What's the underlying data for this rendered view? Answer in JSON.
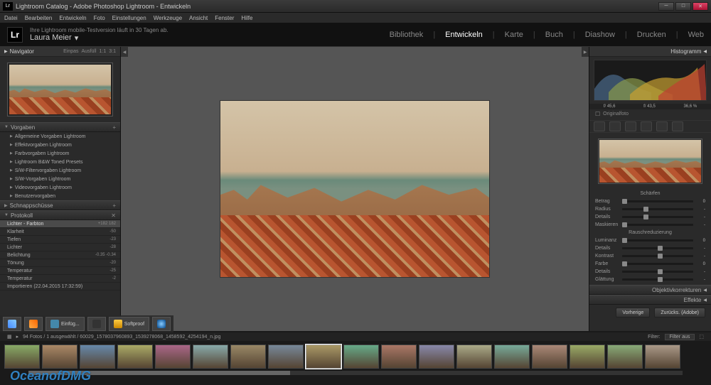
{
  "window": {
    "title": "Lightroom Catalog - Adobe Photoshop Lightroom - Entwickeln"
  },
  "menu": [
    "Datei",
    "Bearbeiten",
    "Entwickeln",
    "Foto",
    "Einstellungen",
    "Werkzeuge",
    "Ansicht",
    "Fenster",
    "Hilfe"
  ],
  "identity": {
    "trial": "Ihre Lightroom mobile-Testversion läuft in 30 Tagen ab.",
    "user": "Laura Meier"
  },
  "modules": [
    "Bibliothek",
    "Entwickeln",
    "Karte",
    "Buch",
    "Diashow",
    "Drucken",
    "Web"
  ],
  "active_module": "Entwickeln",
  "left": {
    "navigator": {
      "title": "Navigator",
      "zoom_labels": [
        "Einpas",
        "Ausfüll",
        "1:1",
        "3:1"
      ]
    },
    "presets": {
      "title": "Vorgaben",
      "items": [
        "Allgemeine Vorgaben Lightroom",
        "Effektvorgaben Lightroom",
        "Farbvorgaben Lightroom",
        "Lightroom B&W Toned Presets",
        "S/W-Filtervorgaben Lightroom",
        "S/W-Vorgaben Lightroom",
        "Videovorgaben Lightroom",
        "Benutzervorgaben"
      ]
    },
    "snapshots": {
      "title": "Schnappschüsse"
    },
    "history": {
      "title": "Protokoll",
      "items": [
        {
          "label": "Lichter - Farbton",
          "val": "+182   182"
        },
        {
          "label": "Klarheit",
          "val": "-50"
        },
        {
          "label": "Tiefen",
          "val": "-23"
        },
        {
          "label": "Lichter",
          "val": "-28"
        },
        {
          "label": "Belichtung",
          "val": "-0.35     -0.34"
        },
        {
          "label": "Tönung",
          "val": "-20"
        },
        {
          "label": "Temperatur",
          "val": "-25"
        },
        {
          "label": "Temperatur",
          "val": "-2"
        },
        {
          "label": "Importieren (22.04.2015 17:32:59)",
          "val": ""
        }
      ]
    }
  },
  "right": {
    "histogram": {
      "title": "Histogramm",
      "stats": [
        "f/ 45,6",
        "f/ 43,5",
        "36,6 %"
      ],
      "original": "Originalfoto"
    },
    "detail": {
      "sharpen": {
        "title": "Schärfen",
        "sliders": [
          {
            "lbl": "Betrag",
            "val": "0",
            "pos": 0
          },
          {
            "lbl": "Radius",
            "val": "-",
            "pos": 30
          },
          {
            "lbl": "Details",
            "val": "-",
            "pos": 30
          },
          {
            "lbl": "Maskieren",
            "val": "-",
            "pos": 0
          }
        ]
      },
      "noise": {
        "title": "Rauschreduzierung",
        "sliders": [
          {
            "lbl": "Luminanz",
            "val": "0",
            "pos": 0
          },
          {
            "lbl": "Details",
            "val": "-",
            "pos": 50
          },
          {
            "lbl": "Kontrast",
            "val": "-",
            "pos": 50
          },
          {
            "lbl": "Farbe",
            "val": "0",
            "pos": 0
          },
          {
            "lbl": "Details",
            "val": "-",
            "pos": 50
          },
          {
            "lbl": "Glättung",
            "val": "-",
            "pos": 50
          }
        ]
      }
    },
    "lens": {
      "title": "Objektivkorrekturen"
    },
    "effects": {
      "title": "Effekte"
    },
    "buttons": {
      "prev": "Vorherige",
      "reset": "Zurücks. (Adobe)"
    }
  },
  "pathbar": {
    "text": "94 Fotos / 1 ausgewählt / 60029_1578037960893_1539278068_1458592_4254194_n.jpg",
    "filter_lbl": "Filter:",
    "filter_val": "Filter aus"
  },
  "watermark": "OceanofDMG"
}
